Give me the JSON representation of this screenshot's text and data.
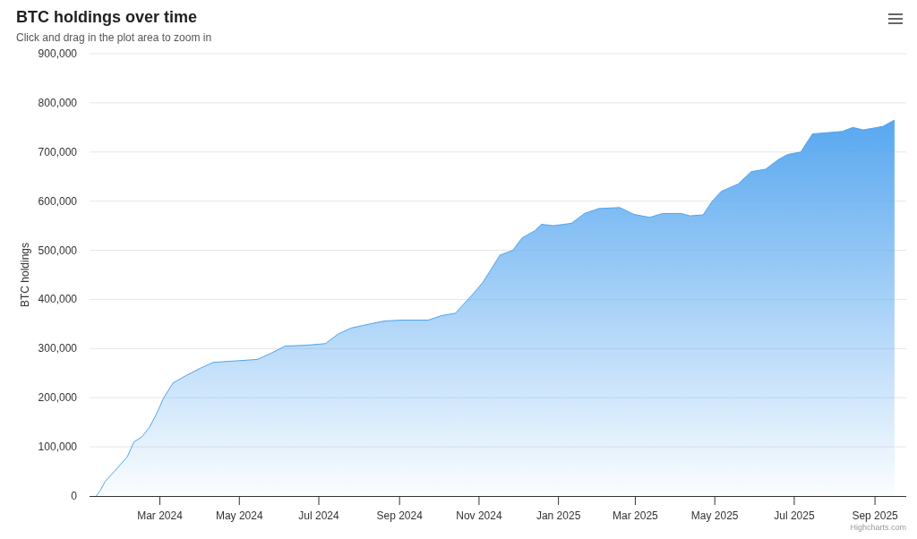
{
  "header": {
    "title": "BTC holdings over time",
    "subtitle": "Click and drag in the plot area to zoom in"
  },
  "chart": {
    "chart_data": {
      "type": "area",
      "grid": "y",
      "ylabel": "BTC holdings",
      "xlim": [
        "2024-01-07",
        "2025-09-25"
      ],
      "ylim": [
        0,
        900000
      ],
      "xticks": [
        {
          "value": "2024-03-01",
          "label": "Mar 2024"
        },
        {
          "value": "2024-05-01",
          "label": "May 2024"
        },
        {
          "value": "2024-07-01",
          "label": "Jul 2024"
        },
        {
          "value": "2024-09-01",
          "label": "Sep 2024"
        },
        {
          "value": "2024-11-01",
          "label": "Nov 2024"
        },
        {
          "value": "2025-01-01",
          "label": "Jan 2025"
        },
        {
          "value": "2025-03-01",
          "label": "Mar 2025"
        },
        {
          "value": "2025-05-01",
          "label": "May 2025"
        },
        {
          "value": "2025-07-01",
          "label": "Jul 2025"
        },
        {
          "value": "2025-09-01",
          "label": "Sep 2025"
        }
      ],
      "yticks": [
        {
          "value": 0,
          "label": "0"
        },
        {
          "value": 100000,
          "label": "100,000"
        },
        {
          "value": 200000,
          "label": "200,000"
        },
        {
          "value": 300000,
          "label": "300,000"
        },
        {
          "value": 400000,
          "label": "400,000"
        },
        {
          "value": 500000,
          "label": "500,000"
        },
        {
          "value": 600000,
          "label": "600,000"
        },
        {
          "value": 700000,
          "label": "700,000"
        },
        {
          "value": 800000,
          "label": "800,000"
        },
        {
          "value": 900000,
          "label": "900,000"
        }
      ],
      "x": [
        "2024-01-12",
        "2024-01-15",
        "2024-01-19",
        "2024-01-26",
        "2024-01-31",
        "2024-02-05",
        "2024-02-10",
        "2024-02-16",
        "2024-02-22",
        "2024-02-27",
        "2024-03-04",
        "2024-03-11",
        "2024-03-21",
        "2024-04-01",
        "2024-04-11",
        "2024-04-28",
        "2024-05-15",
        "2024-05-25",
        "2024-06-05",
        "2024-06-22",
        "2024-07-06",
        "2024-07-16",
        "2024-07-26",
        "2024-08-09",
        "2024-08-20",
        "2024-09-03",
        "2024-09-23",
        "2024-10-03",
        "2024-10-14",
        "2024-10-20",
        "2024-10-27",
        "2024-11-04",
        "2024-11-10",
        "2024-11-17",
        "2024-11-27",
        "2024-12-04",
        "2024-12-14",
        "2024-12-19",
        "2024-12-28",
        "2025-01-11",
        "2025-01-21",
        "2025-02-01",
        "2025-02-17",
        "2025-02-28",
        "2025-03-12",
        "2025-03-22",
        "2025-04-05",
        "2025-04-12",
        "2025-04-22",
        "2025-04-29",
        "2025-05-06",
        "2025-05-19",
        "2025-05-29",
        "2025-06-09",
        "2025-06-19",
        "2025-06-26",
        "2025-07-06",
        "2025-07-15",
        "2025-07-30",
        "2025-08-07",
        "2025-08-15",
        "2025-08-23",
        "2025-09-07",
        "2025-09-16"
      ],
      "series": [
        {
          "color": "#4fa3ef",
          "values": [
            0,
            10000,
            30000,
            50000,
            65000,
            80000,
            110000,
            120000,
            140000,
            165000,
            200000,
            230000,
            245000,
            260000,
            272000,
            275000,
            278000,
            290000,
            305000,
            307000,
            310000,
            330000,
            342000,
            350000,
            356000,
            358000,
            358000,
            367000,
            372000,
            390000,
            410000,
            435000,
            460000,
            490000,
            500000,
            525000,
            540000,
            553000,
            550000,
            555000,
            575000,
            585000,
            587000,
            573000,
            567000,
            575000,
            575000,
            570000,
            572000,
            600000,
            620000,
            635000,
            660000,
            665000,
            685000,
            695000,
            700000,
            737000,
            740000,
            742000,
            750000,
            745000,
            752000,
            765000
          ]
        }
      ]
    },
    "credits": "Highcharts.com"
  }
}
